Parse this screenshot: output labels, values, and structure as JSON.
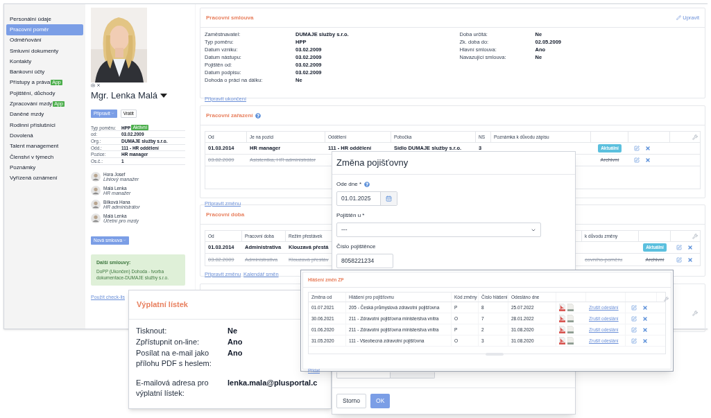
{
  "sidebar": {
    "items": [
      {
        "label": "Personální údaje",
        "selected": false
      },
      {
        "label": "Pracovní poměr",
        "selected": true
      },
      {
        "label": "Odměňování",
        "selected": false
      },
      {
        "label": "Smluvní dokumenty",
        "selected": false
      },
      {
        "label": "Kontakty",
        "selected": false
      },
      {
        "label": "Bankovní účty",
        "selected": false
      },
      {
        "label": "Přístupy a práva",
        "selected": false,
        "badge": "App"
      },
      {
        "label": "Pojištění, důchody",
        "selected": false
      },
      {
        "label": "Zpracování mzdy",
        "selected": false,
        "badge": "App"
      },
      {
        "label": "Daněné mzdy",
        "selected": false
      },
      {
        "label": "Rodinní příslušníci",
        "selected": false
      },
      {
        "label": "Dovolená",
        "selected": false
      },
      {
        "label": "Talent management",
        "selected": false
      },
      {
        "label": "Členství v týmech",
        "selected": false
      },
      {
        "label": "Poznámky",
        "selected": false
      },
      {
        "label": "Vyřízená oznámení",
        "selected": false
      }
    ]
  },
  "profile": {
    "name": "Mgr. Lenka Malá",
    "actions": [
      {
        "label": "Připravit",
        "kind": "dropdown"
      },
      {
        "label": "Vrátit",
        "kind": "plain"
      }
    ],
    "details": [
      {
        "label": "Typ poměru:",
        "value": "HPP",
        "badge": "Aktivní"
      },
      {
        "label": "od:",
        "value": "03.02.2009"
      },
      {
        "label": "Org.:",
        "value": "DUMAJE služby s.r.o."
      },
      {
        "label": "Odd.:",
        "value": "111 - HR oddělení"
      },
      {
        "label": "Pozice:",
        "value": "HR manager"
      },
      {
        "label": "Os.č.:",
        "value": "1"
      }
    ],
    "people": [
      {
        "name": "Hora Josef",
        "role": "Liniový manažer"
      },
      {
        "name": "Malá Lenka",
        "role": "HR manažer"
      },
      {
        "name": "Bílková Hana",
        "role": "HR administrátor"
      },
      {
        "name": "Malá Lenka",
        "role": "Účetní pro mzdy"
      }
    ],
    "new_contract_button": "Nová smlouva",
    "other_contracts": {
      "title": "Další smlouvy:",
      "text": "DoPP (Ukončen) Dohoda - tvorba dokumentace-DUMAJE služby s.r.o."
    },
    "checklist_link": "Použít check-lis"
  },
  "employment_contract": {
    "title": "Pracovní smlouva",
    "edit_link": "Upravit",
    "left_fields": [
      {
        "label": "Zaměstnavatel:",
        "value": "DUMAJE služby s.r.o."
      },
      {
        "label": "Typ poměru:",
        "value": "HPP"
      },
      {
        "label": "Datum vzniku:",
        "value": "03.02.2009"
      },
      {
        "label": "Datum nástupu:",
        "value": "03.02.2009"
      },
      {
        "label": "Pojištěn od:",
        "value": "03.02.2009"
      },
      {
        "label": "Datum podpisu:",
        "value": "03.02.2009"
      },
      {
        "label": "Dohoda o práci na dálku:",
        "value": "Ne"
      }
    ],
    "right_fields": [
      {
        "label": "Doba určitá:",
        "value": "Ne"
      },
      {
        "label": "Zk. doba do:",
        "value": "02.05.2009"
      },
      {
        "label": "Hlavní smlouva:",
        "value": "Ano"
      },
      {
        "label": "Navazující smlouva:",
        "value": "Ne"
      }
    ],
    "link": "Připravit ukončení"
  },
  "job_assignments": {
    "title": "Pracovní zařazení",
    "columns": [
      "Od",
      "Je na pozici",
      "Oddělení",
      "Pobočka",
      "NS",
      "Poznámka k důvodu zápisu"
    ],
    "rows": [
      {
        "from": "01.03.2014",
        "position": "HR manager",
        "department": "111 - HR oddělení",
        "branch": "Sídlo DUMAJE služby s.r.o.",
        "ns": "3",
        "status": "Aktuální",
        "archived": false
      },
      {
        "from": "03.02.2009",
        "position": "Asistentka, HR administrátor",
        "status": "Archivní",
        "archived": true
      }
    ],
    "link": "Připravit změnu"
  },
  "working_hours": {
    "title": "Pracovní doba",
    "columns": [
      "Od",
      "Pracovní doba",
      "Režim přestávek",
      "k důvodu změny"
    ],
    "rows": [
      {
        "from": "01.03.2014",
        "work_time": "Administrativa",
        "breaks": "Klouzavá přestá",
        "status": "Aktuální",
        "archived": false
      },
      {
        "from": "03.02.2009",
        "work_time": "Administrativa",
        "breaks": "Klouzavá přestáv",
        "note": "covního-poměru",
        "status": "Archivní",
        "archived": true
      }
    ],
    "links": [
      "Připravit změnu",
      "Kalendář směn"
    ]
  },
  "payslip_window": {
    "title": "Výplatní lístek",
    "rows": [
      {
        "label": "Tisknout:",
        "value": "Ne"
      },
      {
        "label": "Zpřístupnit on-line:",
        "value": "Ano"
      },
      {
        "label": "Posílat na e-mail jako přílohu PDF s heslem:",
        "value": "Ano"
      },
      {
        "label": "E-mailová adresa pro výplatní lístek:",
        "value": "lenka.mala@plusportal.c"
      }
    ]
  },
  "insurance_change_dialog": {
    "title": "Změna pojišťovny",
    "fields": [
      {
        "kind": "date",
        "label": "Ode dne *",
        "help": true,
        "value": "01.01.2025"
      },
      {
        "kind": "select",
        "label": "Pojištěn u *",
        "help": false,
        "value": "---"
      },
      {
        "kind": "text",
        "label": "Číslo pojištěnce",
        "help": false,
        "value": "8058221234"
      }
    ],
    "buttons": [
      {
        "label": "Storno",
        "primary": false
      },
      {
        "label": "OK",
        "primary": true
      }
    ]
  },
  "insurance_reports_window": {
    "title": "Hlášení změn ZP",
    "columns": [
      "Změna od",
      "Hlášení pro pojišťovnu",
      "Kód změny",
      "Číslo hlášení",
      "Odesláno dne"
    ],
    "rows": [
      {
        "from": "01.07.2021",
        "report": "205 - Česká průmyslová zdravotní pojišťovna",
        "code": "P",
        "number": "8",
        "sent": "25.07.2022",
        "link": "Zrušit odeslání"
      },
      {
        "from": "30.06.2021",
        "report": "211 - Zdravotní pojišťovna ministerstva vnitra",
        "code": "O",
        "number": "7",
        "sent": "28.01.2022",
        "link": "Zrušit odeslání"
      },
      {
        "from": "01.06.2020",
        "report": "211 - Zdravotní pojišťovna ministerstva vnitra",
        "code": "P",
        "number": "2",
        "sent": "31.08.2020",
        "link": "Zrušit odeslání"
      },
      {
        "from": "31.05.2020",
        "report": "111 - Všeobecná zdravotní pojišťovna",
        "code": "O",
        "number": "3",
        "sent": "31.08.2020",
        "link": "Zrušit odeslání"
      }
    ],
    "add_link": "Přidat"
  }
}
